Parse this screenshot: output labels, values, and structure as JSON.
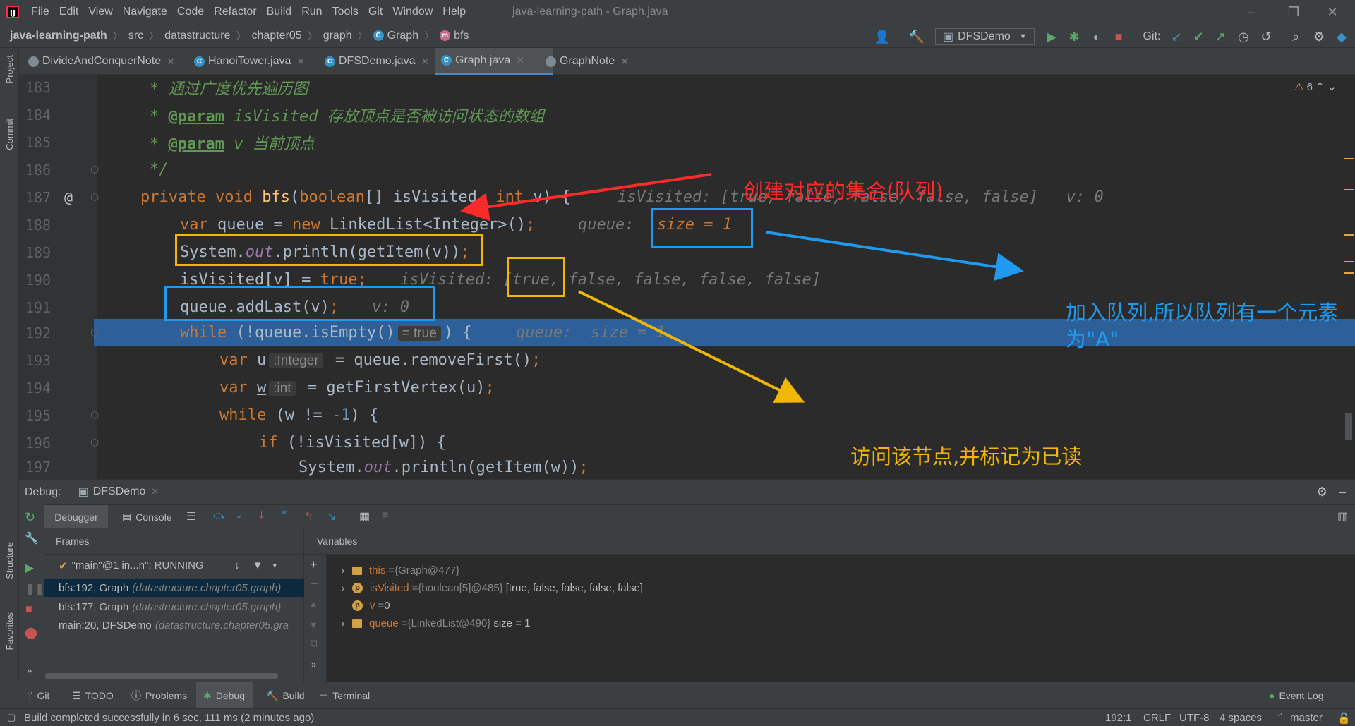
{
  "menu": {
    "items": [
      "File",
      "Edit",
      "View",
      "Navigate",
      "Code",
      "Refactor",
      "Build",
      "Run",
      "Tools",
      "Git",
      "Window",
      "Help"
    ],
    "title": "java-learning-path - Graph.java"
  },
  "nav": {
    "crumbs": [
      "java-learning-path",
      "src",
      "datastructure",
      "chapter05",
      "graph",
      "Graph",
      "bfs"
    ],
    "run_config": "DFSDemo",
    "git_label": "Git:"
  },
  "tabs": [
    "DivideAndConquerNote",
    "HanoiTower.java",
    "DFSDemo.java",
    "Graph.java",
    "GraphNote"
  ],
  "code": {
    "l183": "183",
    "l184": "184",
    "l185": "185",
    "l186": "186",
    "l187": "187",
    "l188": "188",
    "l189": "189",
    "l190": "190",
    "l191": "191",
    "l192": "192",
    "l193": "193",
    "l194": "194",
    "l195": "195",
    "l196": "196",
    "l197": "197",
    "c183": "* 通过广度优先遍历图",
    "c184a": "* ",
    "c184tag": "@param",
    "c184b": " isVisited 存放顶点是否被访问状态的数组",
    "c185a": "* ",
    "c185tag": "@param",
    "c185b": " v 当前顶点",
    "c186": "*/",
    "c187_private": "private ",
    "c187_void": "void ",
    "c187_name": "bfs",
    "c187_p1": "(",
    "c187_bool": "boolean",
    "c187_p2": "[] isVisited, ",
    "c187_int": "int ",
    "c187_p3": "v) {",
    "c187_dbg": "isVisited: [true, false, false, false, false]   v: 0",
    "c188_var": "var ",
    "c188_a": "queue = ",
    "c188_new": "new ",
    "c188_b": "LinkedList<Integer>()",
    "c188_semi": ";",
    "c188_dbg": "queue:  ",
    "c188_size": "size = 1",
    "c189_a": "System.",
    "c189_out": "out",
    "c189_b": ".println(getItem(v))",
    "c189_semi": ";",
    "c190_a": "isVisited[v] = ",
    "c190_true": "true",
    "c190_semi": ";",
    "c190_dbg": "isVisited: [true, false, false, false, false]",
    "c191_a": "queue.addLast(v)",
    "c191_semi": ";",
    "c191_dbg": "v: 0",
    "c192_while": "while ",
    "c192_a": "(!queue.isEmpty()",
    "c192_hint": "= true",
    "c192_b": ") {",
    "c192_dbg": "queue:  size = 1",
    "c193_var": "var ",
    "c193_a": "u",
    "c193_hint": ":Integer",
    "c193_b": " = queue.removeFirst()",
    "c193_semi": ";",
    "c194_var": "var ",
    "c194_a": "w",
    "c194_hint": ":int",
    "c194_b": " = getFirstVertex(u)",
    "c194_semi": ";",
    "c195_while": "while ",
    "c195_a": "(w != ",
    "c195_num": "-1",
    "c195_b": ") {",
    "c196_if": "if ",
    "c196_a": "(!isVisited[w]) {",
    "c197_a": "System.",
    "c197_out": "out",
    "c197_b": ".println(getItem(w))",
    "c197_semi": ";"
  },
  "gutter": {
    "at_sign": "@",
    "warn_count": "6"
  },
  "annotations": {
    "red": "创建对应的集合(队列)",
    "blue": "加入队列,所以队列有一个元素为\"A\"",
    "orange": "访问该节点,并标记为已读"
  },
  "debug": {
    "label": "Debug:",
    "session": "DFSDemo",
    "tab_debugger": "Debugger",
    "tab_console": "Console",
    "frames_title": "Frames",
    "variables_title": "Variables",
    "thread": "\"main\"@1 in...n\": RUNNING",
    "frames": [
      {
        "name": "bfs:192, Graph",
        "pkg": "(datastructure.chapter05.graph)"
      },
      {
        "name": "bfs:177, Graph",
        "pkg": "(datastructure.chapter05.graph)"
      },
      {
        "name": "main:20, DFSDemo",
        "pkg": "(datastructure.chapter05.gra"
      }
    ],
    "vars": [
      {
        "name": "this",
        "eq": " = ",
        "type": "{Graph@477}",
        "val": ""
      },
      {
        "name": "isVisited",
        "eq": " = ",
        "type": "{boolean[5]@485}",
        "val": "[true, false, false, false, false]"
      },
      {
        "name": "v",
        "eq": " = ",
        "type": "",
        "val": "0"
      },
      {
        "name": "queue",
        "eq": " = ",
        "type": "{LinkedList@490}",
        "val": "size = 1"
      }
    ]
  },
  "sidebar": {
    "project": "Project",
    "commit": "Commit",
    "structure": "Structure",
    "favorites": "Favorites"
  },
  "bottom": {
    "git": "Git",
    "todo": "TODO",
    "problems": "Problems",
    "debug": "Debug",
    "build": "Build",
    "terminal": "Terminal",
    "event_log": "Event Log"
  },
  "status": {
    "message": "Build completed successfully in 6 sec, 111 ms (2 minutes ago)",
    "position": "192:1",
    "line_sep": "CRLF",
    "encoding": "UTF-8",
    "indent": "4 spaces",
    "branch": "master"
  },
  "colors": {
    "accent": "#4a88c7",
    "highlight": "#2d6099",
    "red_ann": "#ff2a2a",
    "blue_ann": "#1e9bf0",
    "orange_ann": "#f2b705"
  }
}
